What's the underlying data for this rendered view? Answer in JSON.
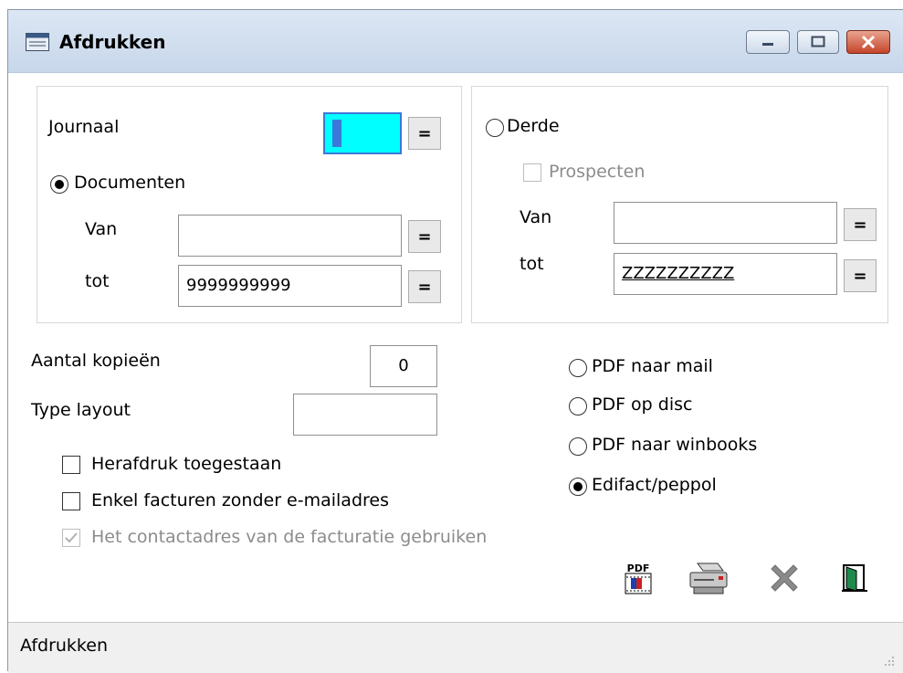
{
  "window": {
    "title": "Afdrukken"
  },
  "left_panel": {
    "journaal_label": "Journaal",
    "journaal_value": "",
    "documenten_label": "Documenten",
    "van_label": "Van",
    "van_value": "",
    "tot_label": "tot",
    "tot_value": "9999999999",
    "eq": "="
  },
  "right_panel": {
    "derde_label": "Derde",
    "prospecten_label": "Prospecten",
    "van_label": "Van",
    "van_value": "",
    "tot_label": "tot",
    "tot_value": "ZZZZZZZZZZ",
    "eq": "="
  },
  "options": {
    "kopieen_label": "Aantal kopieën",
    "kopieen_value": "0",
    "layout_label": "Type layout",
    "layout_value": "",
    "herafdruk_label": "Herafdruk toegestaan",
    "enkel_label": "Enkel facturen zonder e-mailadres",
    "contact_label": "Het contactadres van de facturatie gebruiken"
  },
  "output": {
    "pdf_mail": "PDF naar mail",
    "pdf_disc": "PDF op disc",
    "pdf_winbooks": "PDF naar winbooks",
    "edifact": "Edifact/peppol",
    "selected": "Edifact/peppol"
  },
  "toolbar": {
    "pdf_icon_text": "PDF"
  },
  "statusbar": {
    "text": "Afdrukken"
  },
  "colors": {
    "journaal_field": "#00ffff",
    "cursor": "#3c78d8"
  }
}
